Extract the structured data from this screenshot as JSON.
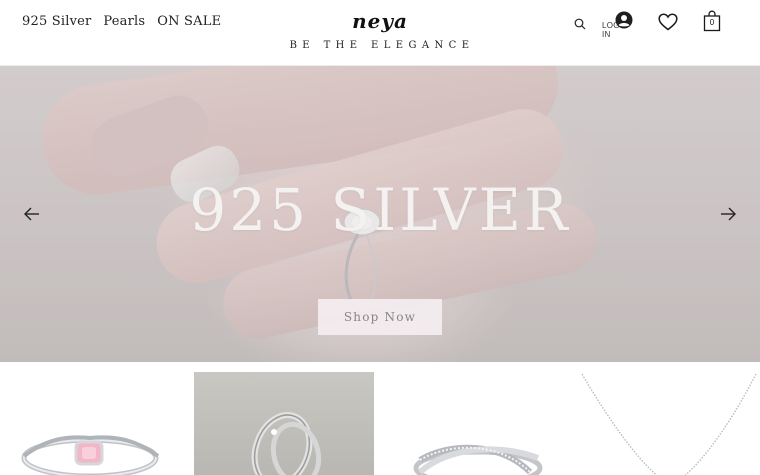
{
  "nav": {
    "items": [
      "925 Silver",
      "Pearls",
      "ON SALE"
    ]
  },
  "logo": {
    "mark": "neya",
    "tagline": "BE THE ELEGANCE"
  },
  "header_actions": {
    "login_label": "LOG IN",
    "cart_count": "0"
  },
  "hero": {
    "title": "925 SILVER",
    "button_label": "Shop Now"
  },
  "products": [
    {
      "icon": "pink-gem-ring-image"
    },
    {
      "icon": "couple-rings-image"
    },
    {
      "icon": "crossover-ring-image"
    },
    {
      "icon": "pendant-necklace-image"
    }
  ],
  "colors": {
    "hero_title": "#f4f1f1",
    "button_bg": "#f4eef0",
    "button_text": "#8a8488"
  }
}
